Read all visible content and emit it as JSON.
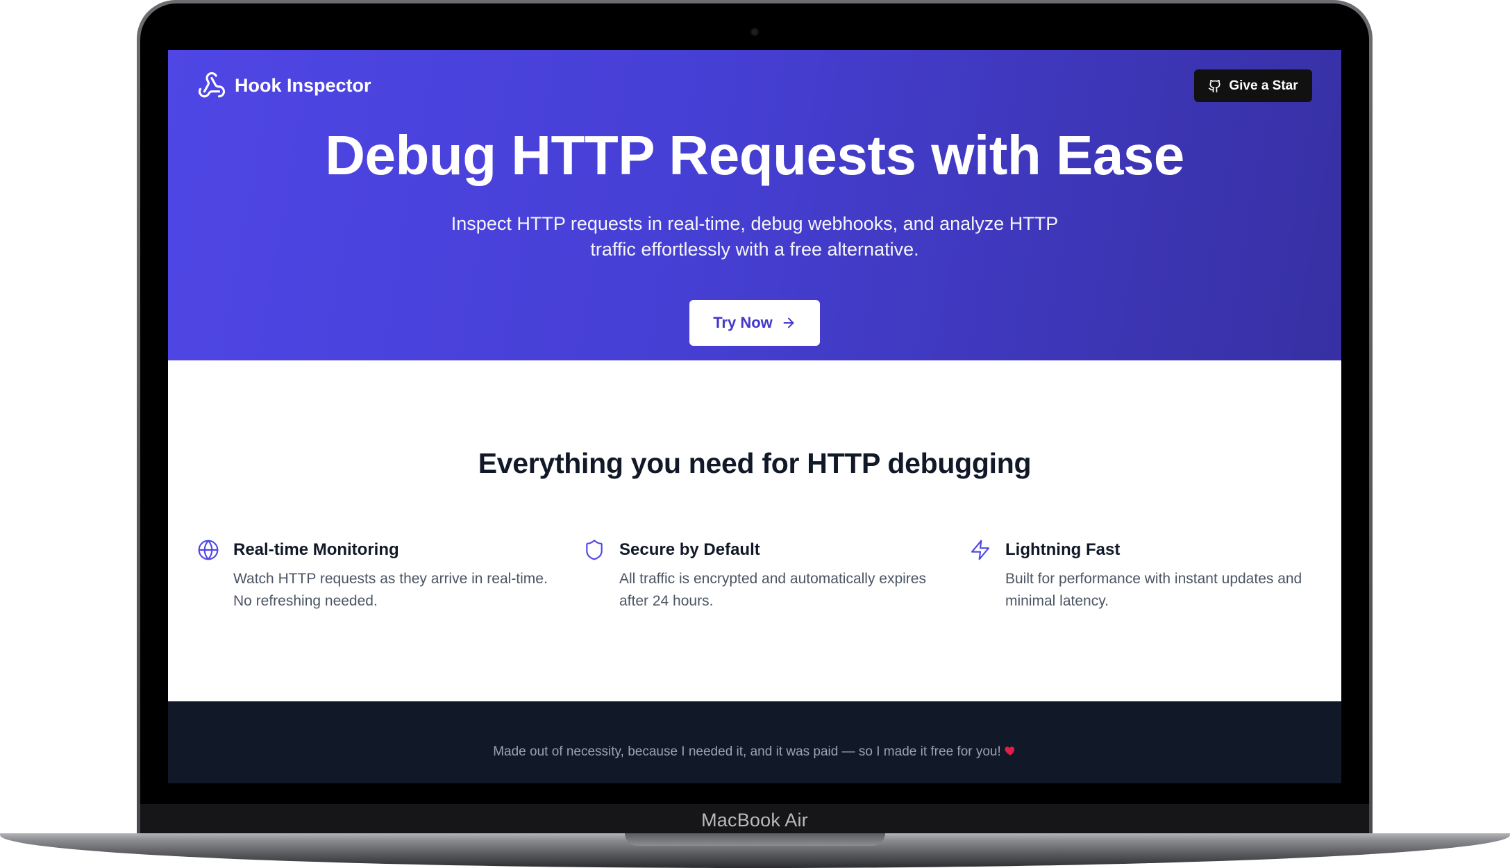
{
  "device": {
    "label": "MacBook Air"
  },
  "header": {
    "brand_name": "Hook Inspector",
    "brand_icon": "webhook-icon",
    "star_button_label": "Give a Star",
    "star_button_icon": "github-icon"
  },
  "hero": {
    "title": "Debug HTTP Requests with Ease",
    "subtitle": "Inspect HTTP requests in real-time, debug webhooks, and analyze HTTP traffic effortlessly with a free alternative.",
    "cta_label": "Try Now",
    "cta_icon": "arrow-right-icon"
  },
  "features": {
    "heading": "Everything you need for HTTP debugging",
    "items": [
      {
        "icon": "globe-icon",
        "title": "Real-time Monitoring",
        "description": "Watch HTTP requests as they arrive in real-time. No refreshing needed."
      },
      {
        "icon": "shield-icon",
        "title": "Secure by Default",
        "description": "All traffic is encrypted and automatically expires after 24 hours."
      },
      {
        "icon": "lightning-icon",
        "title": "Lightning Fast",
        "description": "Built for performance with instant updates and minimal latency."
      }
    ]
  },
  "footer": {
    "text": "Made out of necessity, because I needed it, and it was paid — so I made it free for you!",
    "icon": "heart-icon"
  },
  "colors": {
    "hero_gradient_start": "#4f46e5",
    "hero_gradient_end": "#3730a3",
    "accent": "#4f46e5",
    "heading": "#111827",
    "body_text": "#4b5563",
    "footer_bg": "#111827",
    "footer_text": "#9ca3af"
  }
}
